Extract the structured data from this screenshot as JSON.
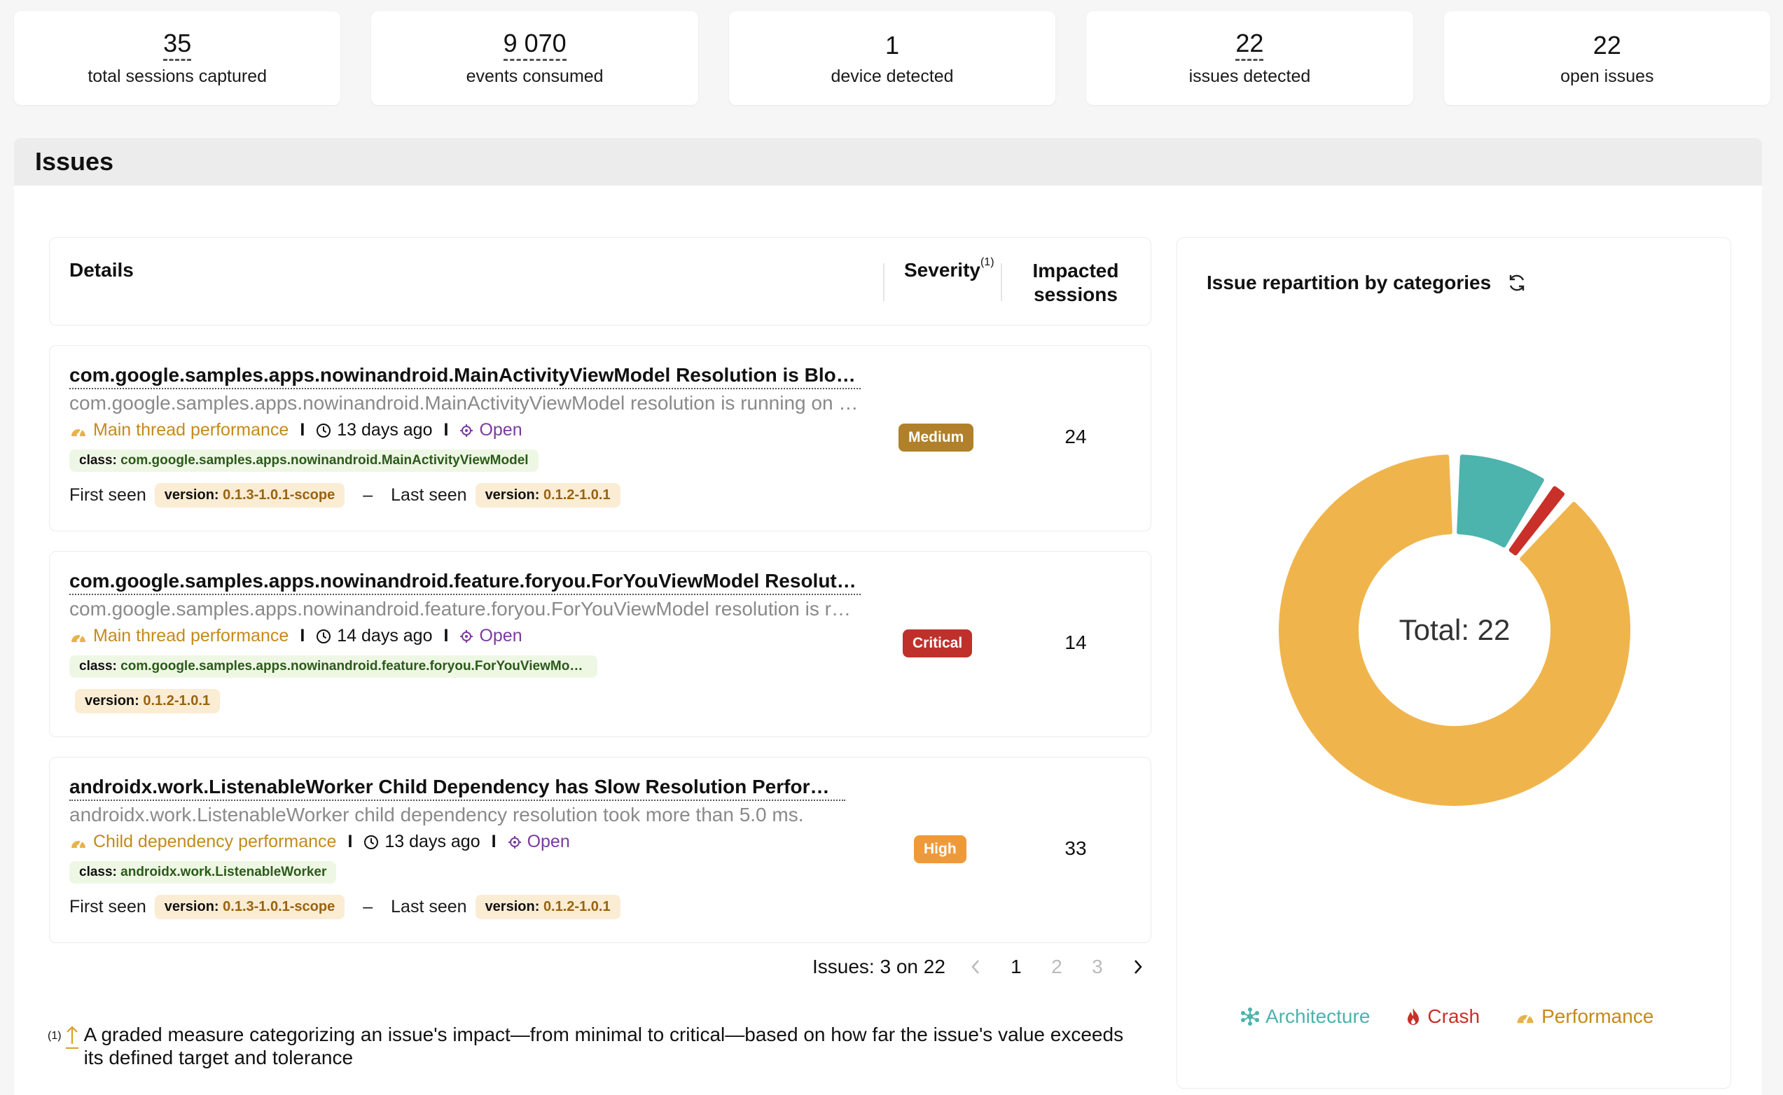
{
  "stats": [
    {
      "value": "35",
      "label": "total sessions captured"
    },
    {
      "value": "9 070",
      "label": "events consumed"
    },
    {
      "value": "1",
      "label": "device detected"
    },
    {
      "value": "22",
      "label": "issues detected"
    },
    {
      "value": "22",
      "label": "open issues"
    }
  ],
  "issues_panel": {
    "title": "Issues",
    "columns": {
      "details": "Details",
      "severity": "Severity",
      "severity_note": "(1)",
      "impacted": "Impacted sessions"
    },
    "items": [
      {
        "title": "com.google.samples.apps.nowinandroid.MainActivityViewModel Resolution is Blocking Main Thread",
        "description": "com.google.samples.apps.nowinandroid.MainActivityViewModel resolution is running on the main thread",
        "category": "Main thread performance",
        "time": "13 days ago",
        "status": "Open",
        "class_label": "class:",
        "class_value": "com.google.samples.apps.nowinandroid.MainActivityViewModel",
        "first_seen_label": "First seen",
        "first_version": "0.1.3-1.0.1-scope",
        "last_seen_label": "Last seen",
        "last_version": "0.1.2-1.0.1",
        "version_label": "version:",
        "separator": "–",
        "severity": "Medium",
        "severity_color": "#b0802a",
        "impacted": "24"
      },
      {
        "title": "com.google.samples.apps.nowinandroid.feature.foryou.ForYouViewModel Resolution is Blocking Main Thread",
        "description": "com.google.samples.apps.nowinandroid.feature.foryou.ForYouViewModel resolution is running on the main thread",
        "category": "Main thread performance",
        "time": "14 days ago",
        "status": "Open",
        "class_label": "class:",
        "class_value": "com.google.samples.apps.nowinandroid.feature.foryou.ForYouViewModel",
        "version_label": "version:",
        "single_version": "0.1.2-1.0.1",
        "severity": "Critical",
        "severity_color": "#c0302b",
        "impacted": "14"
      },
      {
        "title": "androidx.work.ListenableWorker Child Dependency has Slow Resolution Performance",
        "description": "androidx.work.ListenableWorker child dependency resolution took more than 5.0 ms.",
        "category": "Child dependency performance",
        "time": "13 days ago",
        "status": "Open",
        "class_label": "class:",
        "class_value": "androidx.work.ListenableWorker",
        "first_seen_label": "First seen",
        "first_version": "0.1.3-1.0.1-scope",
        "last_seen_label": "Last seen",
        "last_version": "0.1.2-1.0.1",
        "version_label": "version:",
        "separator": "–",
        "severity": "High",
        "severity_color": "#ef9a3a",
        "impacted": "33"
      }
    ],
    "pagination": {
      "summary": "Issues: 3 on 22",
      "pages": [
        "1",
        "2",
        "3"
      ],
      "current": "1"
    },
    "footnote": {
      "mark": "(1)",
      "text": "A graded measure categorizing an issue's impact—from minimal to critical—based on how far the issue's value exceeds its defined target and tolerance"
    }
  },
  "chart_card": {
    "title": "Issue repartition by categories",
    "center_label": "Total: 22",
    "legend": [
      {
        "name": "Architecture",
        "color": "#4cb3ad"
      },
      {
        "name": "Crash",
        "color": "#c93029"
      },
      {
        "name": "Performance",
        "color": "#d9a026"
      }
    ]
  },
  "chart_data": {
    "type": "pie",
    "categories": [
      "Architecture",
      "Crash",
      "Performance"
    ],
    "values": [
      2,
      0.5,
      19.5
    ],
    "colors": [
      "#4cb3ad",
      "#c93029",
      "#efb54c"
    ],
    "total_label": "Total: 22"
  },
  "icons": {
    "category": "gauge-icon",
    "time": "clock-icon",
    "status": "bug-icon",
    "refresh": "refresh-icon",
    "prev": "chevron-left-icon",
    "next": "chevron-right-icon",
    "footnote": "arrow-up-icon"
  }
}
